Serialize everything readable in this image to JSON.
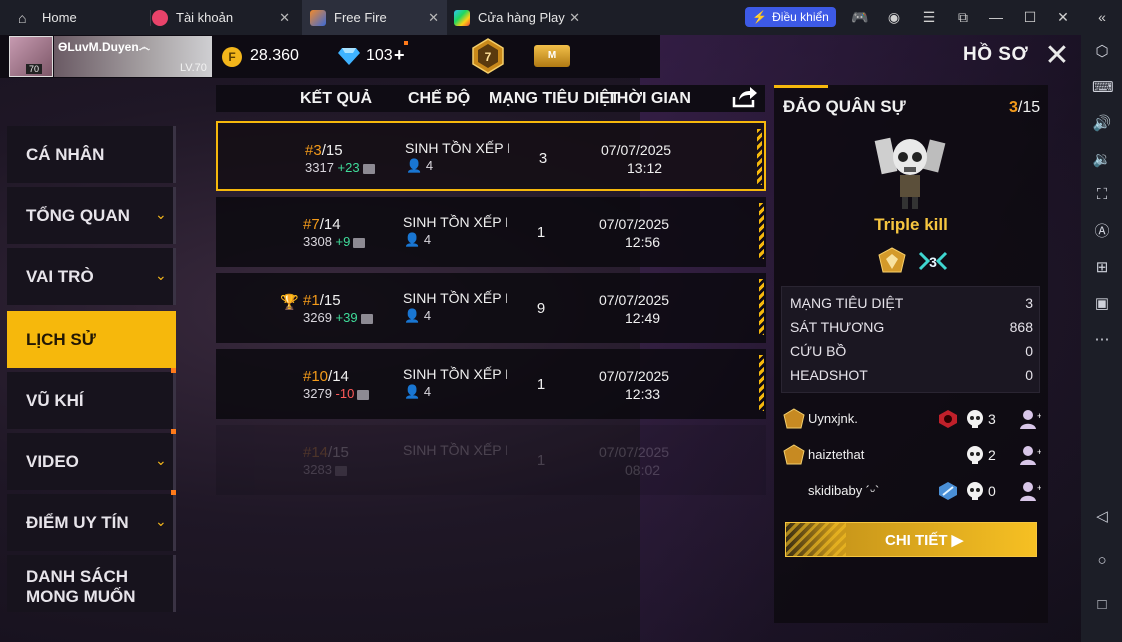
{
  "emulator": {
    "tabs": [
      {
        "label": "Home"
      },
      {
        "label": "Tài khoản"
      },
      {
        "label": "Free Fire"
      },
      {
        "label": "Cửa hàng Play"
      }
    ],
    "control_button": "Điều khiển",
    "accent_color": "#3d5ae6"
  },
  "player": {
    "name": "ϴLuvM.Duyen෴",
    "level_label": "LV.70",
    "avatar_level": "70"
  },
  "currency": {
    "coins": "28.360",
    "diamonds": "103",
    "plus": "+"
  },
  "rank_badge_number": "7",
  "elite_badge_text": "M",
  "page_title": "HỒ SƠ",
  "menu": {
    "items": [
      {
        "label": "CÁ NHÂN"
      },
      {
        "label": "TỔNG QUAN"
      },
      {
        "label": "VAI TRÒ"
      },
      {
        "label": "LỊCH SỬ"
      },
      {
        "label": "VŨ KHÍ"
      },
      {
        "label": "VIDEO"
      },
      {
        "label": "ĐIỂM UY TÍN"
      },
      {
        "label": "DANH SÁCH MONG MUỐN"
      }
    ],
    "active": "LỊCH SỬ"
  },
  "table": {
    "headers": {
      "result": "KẾT QUẢ",
      "mode": "CHẾ ĐỘ",
      "kills": "MẠNG TIÊU DIỆT",
      "time": "THỜI GIAN"
    },
    "rows": [
      {
        "rank": "3",
        "total": "/15",
        "points": "3317",
        "delta": "+23",
        "mode": "SINH TỒN XẾP HẠ",
        "party": "4",
        "kills": "3",
        "date": "07/07/2025",
        "time": "13:12"
      },
      {
        "rank": "7",
        "total": "/14",
        "points": "3308",
        "delta": "+9",
        "mode": "SINH TỒN XẾP HẠ",
        "party": "4",
        "kills": "1",
        "date": "07/07/2025",
        "time": "12:56"
      },
      {
        "rank": "1",
        "total": "/15",
        "points": "3269",
        "delta": "+39",
        "mode": "SINH TỒN XẾP HẠ",
        "party": "4",
        "kills": "9",
        "date": "07/07/2025",
        "time": "12:49"
      },
      {
        "rank": "10",
        "total": "/14",
        "points": "3279",
        "delta": "-10",
        "mode": "SINH TỒN XẾP HẠ",
        "party": "4",
        "kills": "1",
        "date": "07/07/2025",
        "time": "12:33"
      },
      {
        "rank": "14",
        "total": "/15",
        "points": "3283",
        "delta": "",
        "mode": "SINH TỒN XẾP HẠ",
        "party": "",
        "kills": "1",
        "date": "07/07/2025",
        "time": "08:02"
      }
    ]
  },
  "detail": {
    "title": "ĐẢO QUÂN SỰ",
    "placement": "3",
    "placement_total": "/15",
    "award": "Triple kill",
    "stats": [
      {
        "label": "MẠNG TIÊU DIỆT",
        "value": "3"
      },
      {
        "label": "SÁT THƯƠNG",
        "value": "868"
      },
      {
        "label": "CỨU BỒ",
        "value": "0"
      },
      {
        "label": "HEADSHOT",
        "value": "0"
      }
    ],
    "team": [
      {
        "name": "Uynxjnk.",
        "kills": "3"
      },
      {
        "name": "haiztethat",
        "kills": "2"
      },
      {
        "name": "skidibaby ´ᵕ`",
        "kills": "0"
      }
    ],
    "detail_button": "CHI TIẾT"
  }
}
